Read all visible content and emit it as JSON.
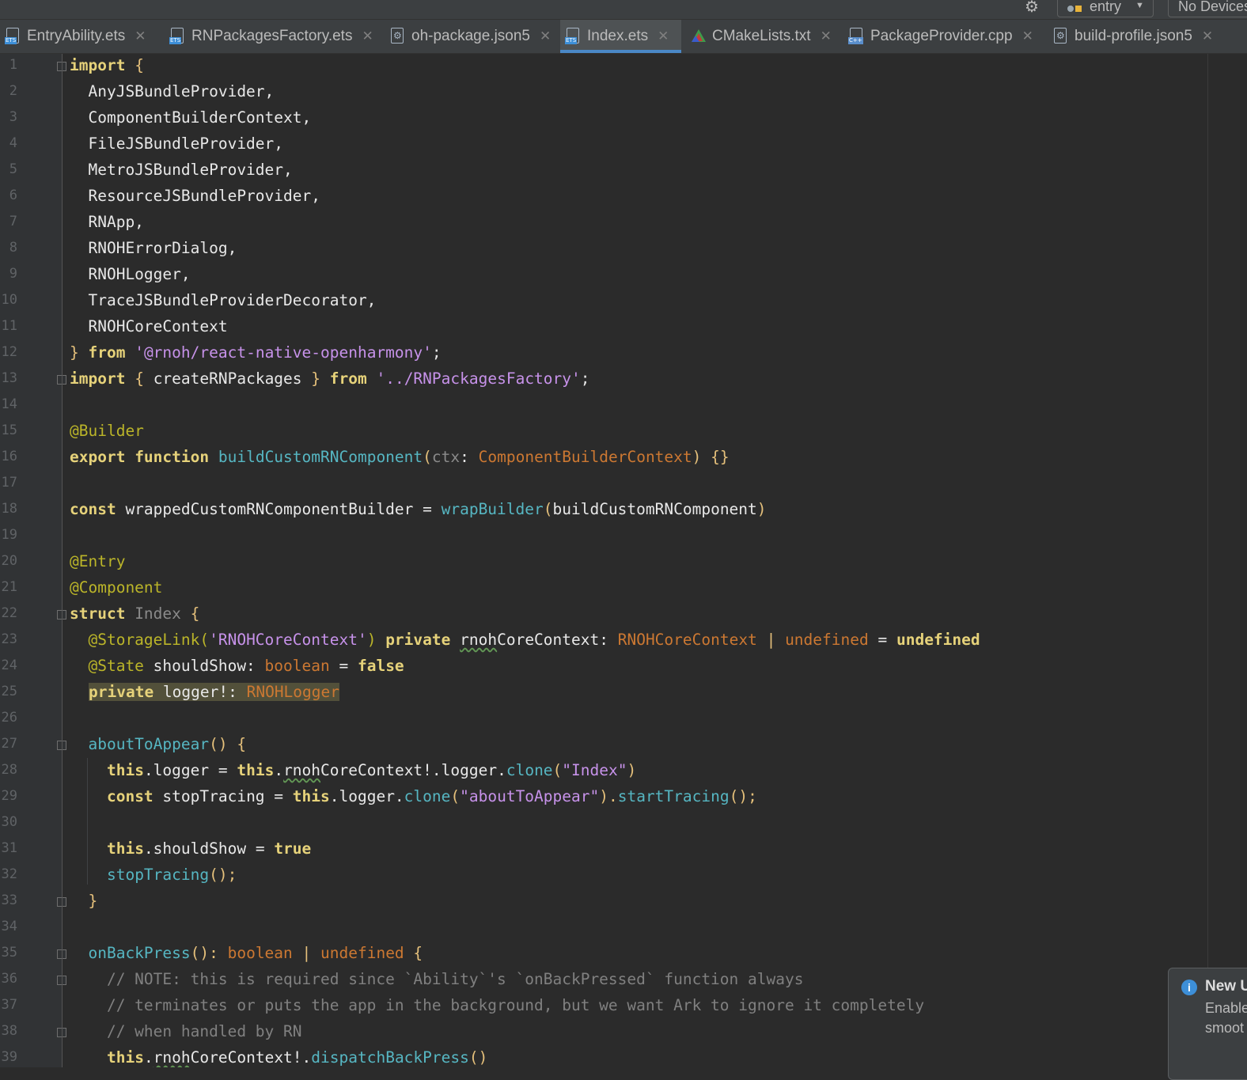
{
  "toolbar": {
    "run_config": "entry",
    "device": "No Devices"
  },
  "tabs": [
    {
      "label": "EntryAbility.ets",
      "icon": "ets-file-icon",
      "badge": "ETS"
    },
    {
      "label": "RNPackagesFactory.ets",
      "icon": "ets-file-icon",
      "badge": "ETS"
    },
    {
      "label": "oh-package.json5",
      "icon": "json5-file-icon"
    },
    {
      "label": "Index.ets",
      "icon": "ets-file-icon",
      "badge": "ETS",
      "active": true
    },
    {
      "label": "CMakeLists.txt",
      "icon": "cmake-icon"
    },
    {
      "label": "PackageProvider.cpp",
      "icon": "cpp-file-icon",
      "badge": "C++"
    },
    {
      "label": "build-profile.json5",
      "icon": "json5-file-icon"
    }
  ],
  "editor": {
    "line_numbers": [
      "1",
      "2",
      "3",
      "4",
      "5",
      "6",
      "7",
      "8",
      "9",
      "10",
      "11",
      "12",
      "13",
      "14",
      "15",
      "16",
      "17",
      "18",
      "19",
      "20",
      "21",
      "22",
      "23",
      "24",
      "25",
      "26",
      "27",
      "28",
      "29",
      "30",
      "31",
      "32",
      "33",
      "34",
      "35",
      "36",
      "37",
      "38",
      "39"
    ],
    "lines": {
      "l1": [
        "import",
        " {"
      ],
      "l2": "  AnyJSBundleProvider,",
      "l3": "  ComponentBuilderContext,",
      "l4": "  FileJSBundleProvider,",
      "l5": "  MetroJSBundleProvider,",
      "l6": "  ResourceJSBundleProvider,",
      "l7": "  RNApp,",
      "l8": "  RNOHErrorDialog,",
      "l9": "  RNOHLogger,",
      "l10": "  TraceJSBundleProviderDecorator,",
      "l11": "  RNOHCoreContext",
      "l12": [
        "}",
        " from ",
        "'@rnoh/react-native-openharmony'",
        ";"
      ],
      "l13": [
        "import",
        " { ",
        "createRNPackages",
        " } ",
        "from",
        " '../RNPackagesFactory'",
        ";"
      ],
      "l15": "@Builder",
      "l16": [
        "export",
        " function",
        " buildCustomRNComponent",
        "(",
        "ctx",
        ": ",
        "ComponentBuilderContext",
        ") ",
        "{}"
      ],
      "l18": [
        "const",
        " wrappedCustomRNComponentBuilder = ",
        "wrapBuilder",
        "(",
        "buildCustomRNComponent",
        ")"
      ],
      "l20": "@Entry",
      "l21": "@Component",
      "l22": [
        "struct",
        " Index",
        " {"
      ],
      "l23": [
        "  @StorageLink(",
        "'RNOHCoreContext'",
        ") ",
        "private",
        " ",
        "rnoh",
        "CoreContext: ",
        "RNOHCoreContext",
        " | ",
        "undefined",
        " = ",
        "undefined"
      ],
      "l24": [
        "  @State",
        " shouldShow: ",
        "boolean",
        " = ",
        "false"
      ],
      "l25": [
        "private",
        " logger!: ",
        "RNOHLogger"
      ],
      "l27": [
        "  ",
        "aboutToAppear",
        "() ",
        "{"
      ],
      "l28": [
        "    ",
        "this",
        ".logger = ",
        "this",
        ".",
        "rnoh",
        "CoreContext!.logger.",
        "clone",
        "(",
        "\"Index\"",
        ")"
      ],
      "l29": [
        "    ",
        "const",
        " stopTracing = ",
        "this",
        ".logger.",
        "clone",
        "(",
        "\"aboutToAppear\"",
        ").",
        "startTracing",
        "();"
      ],
      "l31": [
        "    ",
        "this",
        ".shouldShow = ",
        "true"
      ],
      "l32": [
        "    ",
        "stopTracing",
        "();"
      ],
      "l33": "  }",
      "l35": [
        "  ",
        "onBackPress",
        "(): ",
        "boolean",
        " | ",
        "undefined",
        " {"
      ],
      "l36": "    // NOTE: this is required since `Ability`'s `onBackPressed` function always",
      "l37": "    // terminates or puts the app in the background, but we want Ark to ignore it completely",
      "l38": "    // when handled by RN",
      "l39": [
        "    ",
        "this",
        ".",
        "rnoh",
        "CoreContext!.",
        "dispatchBackPress",
        "()"
      ]
    }
  },
  "notification": {
    "title": "New U",
    "line1": "Enable",
    "line2": "smoot"
  },
  "colors": {
    "background": "#2b2b2b",
    "keyword": "#cc7832",
    "string": "#c792ea",
    "function": "#56b6c2",
    "annotation": "#bbb529",
    "comment": "#808080",
    "active_tab_underline": "#4a88c7"
  }
}
